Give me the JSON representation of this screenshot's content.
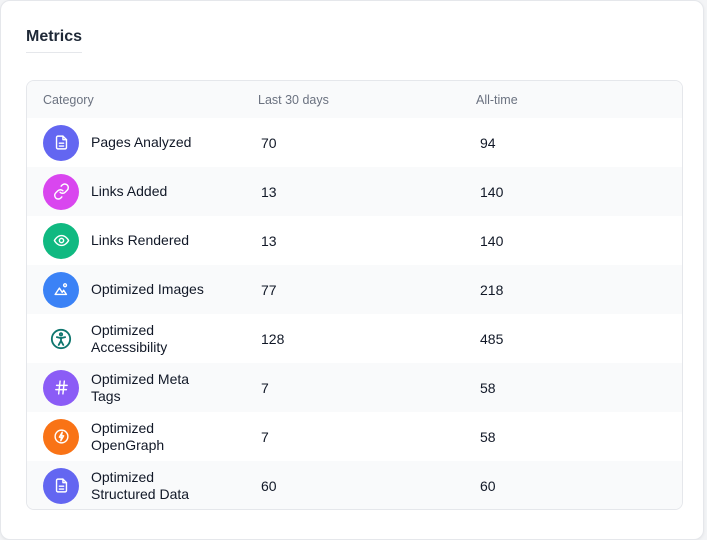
{
  "card": {
    "title": "Metrics"
  },
  "table": {
    "headers": {
      "category": "Category",
      "last30": "Last 30 days",
      "alltime": "All-time"
    },
    "rows": [
      {
        "label": "Pages Analyzed",
        "last30": "70",
        "alltime": "94",
        "icon": "document-icon",
        "color": "#6366f1"
      },
      {
        "label": "Links Added",
        "last30": "13",
        "alltime": "140",
        "icon": "link-icon",
        "color": "#d946ef"
      },
      {
        "label": "Links Rendered",
        "last30": "13",
        "alltime": "140",
        "icon": "eye-icon",
        "color": "#10b981"
      },
      {
        "label": "Optimized Images",
        "last30": "77",
        "alltime": "218",
        "icon": "image-icon",
        "color": "#3b82f6"
      },
      {
        "label": "Optimized Accessibility",
        "last30": "128",
        "alltime": "485",
        "icon": "accessibility-icon",
        "color": "#0f766e"
      },
      {
        "label": "Optimized Meta Tags",
        "last30": "7",
        "alltime": "58",
        "icon": "hash-icon",
        "color": "#8b5cf6"
      },
      {
        "label": "Optimized OpenGraph",
        "last30": "7",
        "alltime": "58",
        "icon": "bolt-icon",
        "color": "#f97316"
      },
      {
        "label": "Optimized Structured Data",
        "last30": "60",
        "alltime": "60",
        "icon": "document-icon",
        "color": "#6366f1"
      }
    ]
  }
}
